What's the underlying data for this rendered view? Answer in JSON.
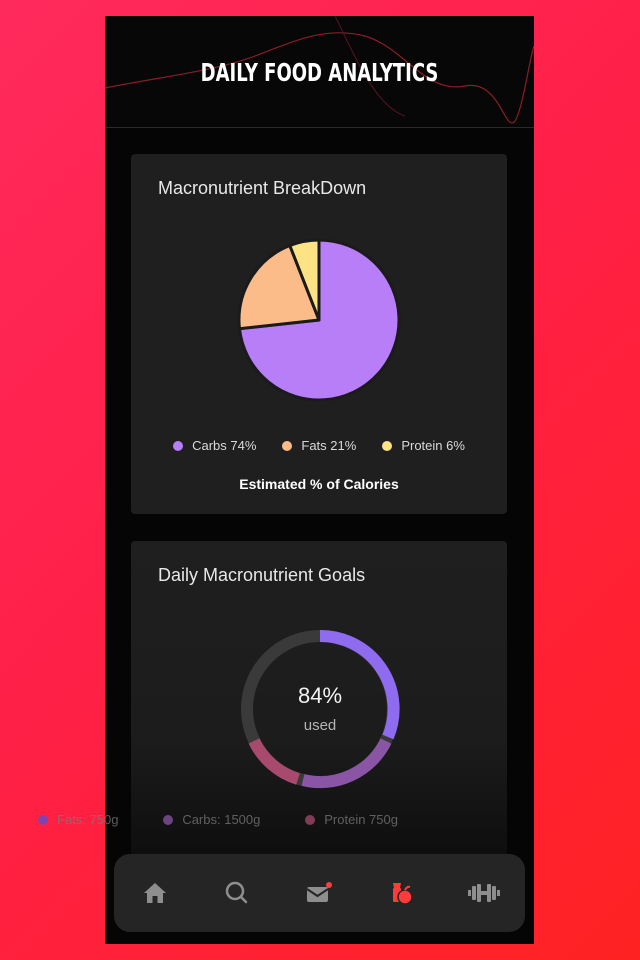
{
  "header": {
    "title": "DAILY FOOD ANALYTICS"
  },
  "breakdown": {
    "title": "Macronutrient BreakDown",
    "caption": "Estimated % of Calories",
    "legend": [
      {
        "label": "Carbs 74%",
        "color": "#b77ef8"
      },
      {
        "label": "Fats 21%",
        "color": "#fcbc8a"
      },
      {
        "label": "Protein 6%",
        "color": "#fde383"
      }
    ]
  },
  "chart_data": {
    "type": "pie",
    "categories": [
      "Carbs",
      "Fats",
      "Protein"
    ],
    "values": [
      74,
      21,
      6
    ],
    "title": "Macronutrient BreakDown"
  },
  "goals": {
    "title": "Daily Macronutrient Goals",
    "percent": "84%",
    "percent_value": 84,
    "used_label": "used",
    "legend": [
      {
        "label": "Fats: 750g",
        "color": "#5a4ed0"
      },
      {
        "label": "Carbs: 1500g",
        "color": "#8a55a5"
      },
      {
        "label": "Protein 750g",
        "color": "#a84a6e"
      }
    ]
  },
  "nav": {
    "items": [
      {
        "name": "home-icon",
        "active": false
      },
      {
        "name": "search-icon",
        "active": false
      },
      {
        "name": "mail-icon",
        "active": false
      },
      {
        "name": "food-icon",
        "active": true
      },
      {
        "name": "dumbbell-icon",
        "active": false
      }
    ],
    "active_color": "#ff3b3b",
    "inactive_color": "#8e8e8e"
  }
}
